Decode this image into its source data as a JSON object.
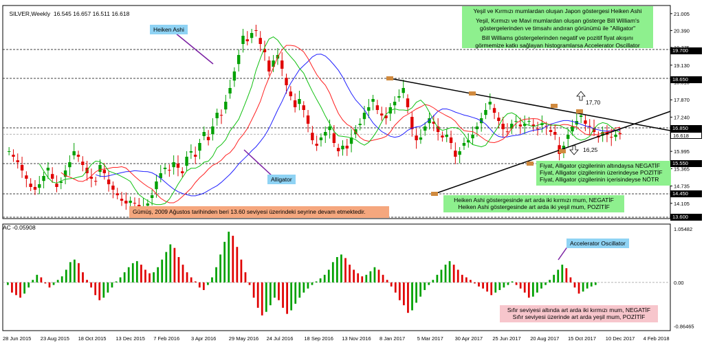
{
  "header": {
    "symbol": "SILVER,Weekly",
    "ohlc": "16.545 16.657 16.511 16.618"
  },
  "indicator_header": "AC -0.05908",
  "annotations": {
    "heiken_tag": "Heiken Ashi",
    "alligator_tag": "Alligator",
    "ac_tag": "Accelerator Oscillator",
    "legend_line1": "Yeşil ve Kırmızı mumlardan oluşan Japon göstergesi Heiken Ashi",
    "legend_line2": "Yeşil, Kırmızı ve Mavi mumlardan oluşan gösterge Bill William's",
    "legend_line3": "göstergelerinden ve timsahı andıran görünümü ile \"Alligator\"",
    "legend_line4": "Bill Williams göstergelerinden negatif ve pozitif fiyat akışını",
    "legend_line5": "görmemize katkı sağlayan histogramlarsa Accelerator Oscillator",
    "alligator_rule1": "Fiyat, Alligator çizgilerinin altındaysa NEGATİF",
    "alligator_rule2": "Fiyat, Alligator çizgilerinin üzerindeyse POZİTİF",
    "alligator_rule3": "Fiyat, Alligator çizgilerinin içerisindeyse NÖTR",
    "heiken_rule1": "Heiken Ashi göstergesinde art arda iki kırmızı mum, NEGATİF",
    "heiken_rule2": "Heiken Ashi göstergesinde art arda iki  yeşil mum, POZİTİF",
    "silver_note": "Gümüş, 2009 Ağustos tarihinden beri 13.60 seviyesi  üzerindeki seyrine devam etmektedir.",
    "ac_rule1": "Sıfır seviyesi altında art arda iki kırmızı mum, NEGATİF",
    "ac_rule2": "Sıfır seviyesi üzerinde art arda yeşil mum, POZİTİF",
    "level_1770": "17,70",
    "level_1625": "16,25"
  },
  "price_levels": [
    {
      "label": "19.700",
      "value": 19.7
    },
    {
      "label": "18.650",
      "value": 18.65
    },
    {
      "label": "16.850",
      "value": 16.85
    },
    {
      "label": "16.618",
      "value": 16.618,
      "current": true
    },
    {
      "label": "15.550",
      "value": 15.55
    },
    {
      "label": "14.450",
      "value": 14.45
    },
    {
      "label": "13.600",
      "value": 13.6
    }
  ],
  "chart_data": [
    {
      "type": "candlestick",
      "panel": "price",
      "title": "SILVER,Weekly",
      "ylim": [
        13.55,
        21.3
      ],
      "yticks": [
        "21.005",
        "20.390",
        "19.775",
        "19.130",
        "18.510",
        "17.870",
        "17.240",
        "16.610",
        "15.995",
        "15.365",
        "14.735",
        "14.105"
      ],
      "x_ticks": [
        "28 Jun 2015",
        "23 Aug 2015",
        "18 Oct 2015",
        "13 Dec 2015",
        "7 Feb 2016",
        "3 Apr 2016",
        "29 May 2016",
        "24 Jul 2016",
        "18 Sep 2016",
        "13 Nov 2016",
        "8 Jan 2017",
        "5 Mar 2017",
        "30 Apr 2017",
        "25 Jun 2017",
        "20 Aug 2017",
        "15 Oct 2017",
        "10 Dec 2017",
        "4 Feb 2018"
      ],
      "close": [
        16.0,
        15.8,
        15.6,
        15.3,
        15.0,
        14.7,
        14.6,
        14.8,
        15.1,
        15.4,
        15.0,
        14.7,
        14.9,
        15.3,
        15.6,
        16.0,
        15.8,
        15.5,
        15.2,
        15.0,
        14.9,
        15.5,
        15.2,
        14.8,
        14.6,
        14.4,
        14.2,
        14.1,
        14.2,
        14.1,
        13.9,
        14.0,
        14.1,
        14.4,
        14.9,
        15.2,
        15.4,
        15.3,
        15.6,
        15.4,
        15.2,
        15.8,
        16.0,
        15.8,
        16.3,
        16.7,
        16.4,
        16.9,
        17.4,
        17.3,
        17.8,
        18.3,
        18.9,
        19.5,
        20.2,
        20.0,
        20.3,
        20.4,
        19.9,
        19.6,
        18.9,
        19.3,
        19.5,
        19.0,
        18.4,
        18.0,
        17.6,
        17.9,
        17.5,
        17.0,
        16.4,
        16.2,
        16.5,
        16.7,
        16.9,
        16.3,
        16.0,
        16.2,
        16.1,
        16.5,
        16.8,
        17.0,
        17.4,
        17.6,
        17.9,
        17.5,
        17.3,
        17.2,
        17.6,
        17.8,
        18.0,
        18.3,
        17.6,
        16.8,
        16.4,
        16.5,
        16.9,
        17.2,
        17.0,
        16.7,
        16.5,
        16.6,
        16.3,
        15.8,
        16.0,
        16.3,
        16.4,
        16.6,
        16.9,
        17.2,
        17.5,
        17.8,
        17.4,
        17.1,
        16.8,
        16.7,
        17.0,
        17.1,
        16.9,
        17.0,
        17.1,
        16.9,
        16.8,
        17.0,
        16.9,
        16.7,
        16.6,
        15.9,
        16.2,
        16.6,
        16.9,
        17.1,
        17.3,
        17.0,
        16.9,
        16.7,
        16.5,
        16.7,
        16.6,
        16.5,
        16.6,
        16.618
      ],
      "series": [
        {
          "name": "Alligator",
          "role": "jaw",
          "color": "#2020ff"
        },
        {
          "name": "Alligator",
          "role": "teeth",
          "color": "#ff2020"
        },
        {
          "name": "Alligator",
          "role": "lips",
          "color": "#10c010"
        }
      ],
      "trendlines": [
        {
          "from": [
            "5 Mar 2017",
            18.65
          ],
          "to": [
            "4 Feb 2018",
            16.85
          ],
          "extend": true
        },
        {
          "from": [
            "25 Jun 2017",
            14.45
          ],
          "to": [
            "4 Feb 2018",
            16.25
          ],
          "extend": true
        }
      ]
    },
    {
      "type": "bar",
      "panel": "indicator",
      "title": "AC -0.05908",
      "yticks": [
        "1.05482",
        "0.00",
        "-0.86465"
      ],
      "ylim": [
        -0.95,
        1.15
      ],
      "values": [
        -0.05,
        -0.2,
        -0.25,
        -0.3,
        -0.22,
        -0.1,
        0.05,
        0.15,
        0.1,
        -0.02,
        -0.1,
        -0.05,
        0.05,
        0.12,
        0.25,
        0.4,
        0.45,
        0.38,
        0.2,
        0.05,
        -0.1,
        -0.25,
        -0.35,
        -0.3,
        -0.2,
        -0.1,
        0.02,
        0.1,
        0.2,
        0.3,
        0.38,
        0.42,
        0.35,
        0.25,
        0.18,
        0.2,
        0.3,
        0.45,
        0.6,
        0.75,
        0.68,
        0.5,
        0.35,
        0.2,
        0.1,
        0.02,
        -0.1,
        -0.15,
        -0.05,
        0.1,
        0.3,
        0.55,
        0.8,
        1.0,
        0.92,
        0.7,
        0.45,
        0.2,
        -0.05,
        -0.3,
        -0.5,
        -0.65,
        -0.58,
        -0.45,
        -0.3,
        -0.35,
        -0.5,
        -0.62,
        -0.55,
        -0.42,
        -0.3,
        -0.2,
        -0.12,
        -0.05,
        0.02,
        0.08,
        0.15,
        0.25,
        0.4,
        0.5,
        0.55,
        0.48,
        0.35,
        0.25,
        0.18,
        0.12,
        0.15,
        0.22,
        0.3,
        0.25,
        0.15,
        0.05,
        -0.08,
        -0.2,
        -0.35,
        -0.45,
        -0.6,
        -0.55,
        -0.4,
        -0.28,
        -0.15,
        -0.05,
        0.05,
        0.15,
        0.25,
        0.35,
        0.42,
        0.35,
        0.25,
        0.15,
        0.1,
        0.05,
        -0.02,
        -0.08,
        -0.12,
        -0.18,
        -0.25,
        -0.2,
        -0.15,
        -0.1,
        -0.05,
        0.02,
        -0.05,
        -0.12,
        -0.2,
        -0.3,
        -0.28,
        -0.2,
        -0.12,
        -0.05,
        0.05,
        0.15,
        0.25,
        0.35,
        0.28,
        0.1,
        -0.1,
        -0.22,
        -0.18,
        -0.12,
        -0.08,
        -0.05
      ]
    }
  ]
}
